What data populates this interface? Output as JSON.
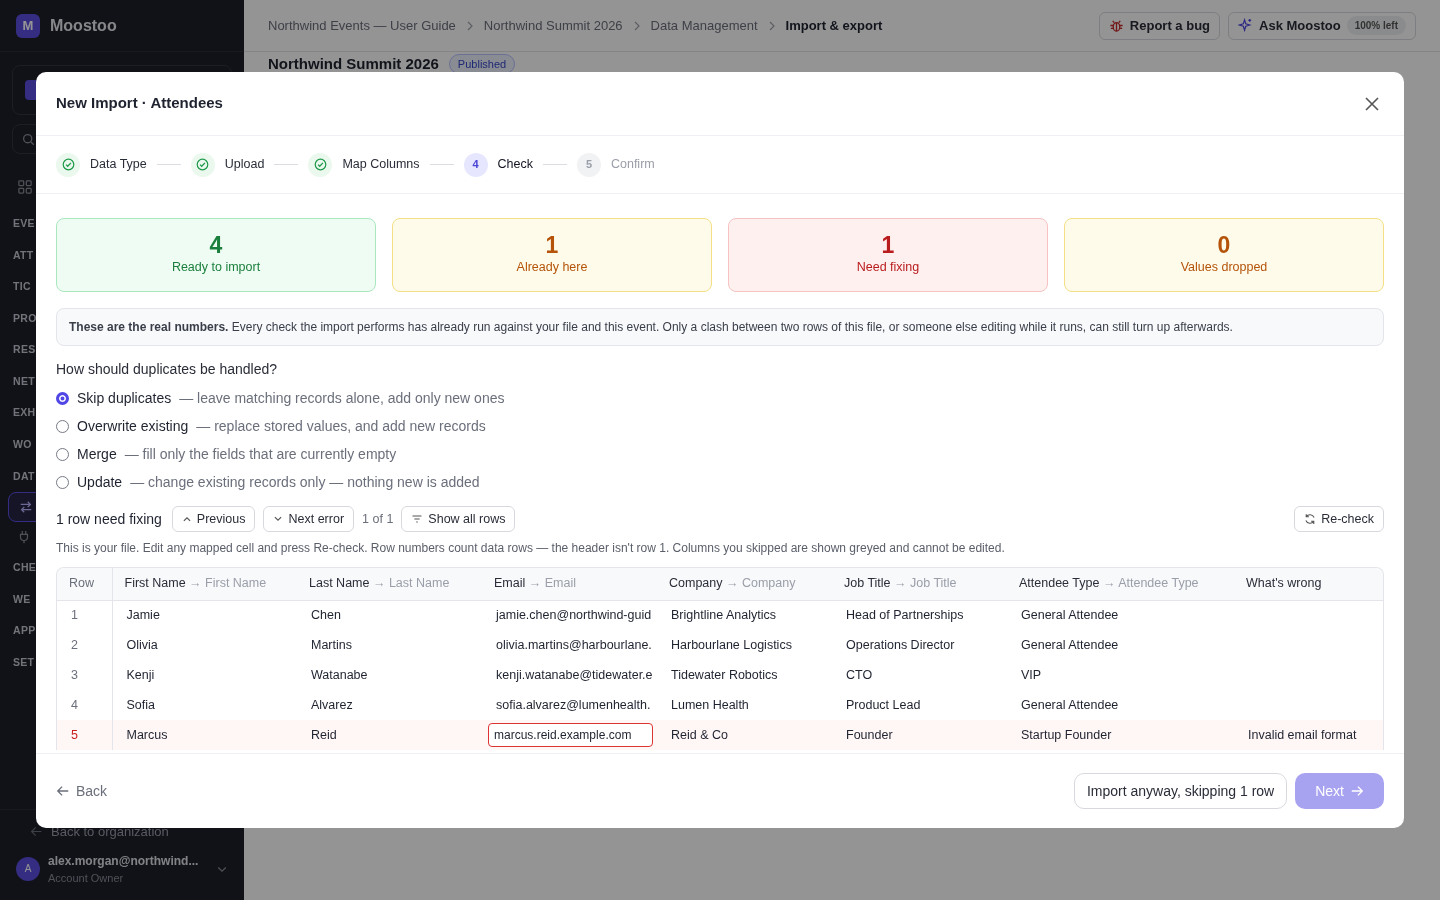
{
  "app": {
    "logo_letter": "M",
    "name": "Moostoo"
  },
  "sidebar": {
    "sections": [
      {
        "label": "EVE"
      },
      {
        "label": "ATT"
      },
      {
        "label": "TIC"
      },
      {
        "label": "PRO"
      },
      {
        "label": "RES"
      },
      {
        "label": "NET"
      },
      {
        "label": "EXH"
      },
      {
        "label": "WO"
      },
      {
        "label": "DAT"
      },
      {
        "label": "CHE"
      },
      {
        "label": "WE"
      },
      {
        "label": "APP"
      },
      {
        "label": "SET"
      }
    ],
    "back_link": "Back to organization",
    "user": {
      "avatar": "A",
      "email": "alex.morgan@northwind...",
      "role": "Account Owner"
    }
  },
  "breadcrumbs": [
    {
      "label": "Northwind Events — User Guide",
      "current": false
    },
    {
      "label": "Northwind Summit 2026",
      "current": false
    },
    {
      "label": "Data Management",
      "current": false
    },
    {
      "label": "Import & export",
      "current": true
    }
  ],
  "top_actions": {
    "report": "Report a bug",
    "ask": "Ask Moostoo",
    "ask_badge": "100% left"
  },
  "page": {
    "title": "Northwind Summit 2026",
    "status": "Published"
  },
  "modal": {
    "title": "New Import · Attendees",
    "steps": [
      {
        "label": "Data Type",
        "done": true,
        "current": false
      },
      {
        "label": "Upload",
        "done": true,
        "current": false
      },
      {
        "label": "Map Columns",
        "done": true,
        "current": false
      },
      {
        "number": "4",
        "label": "Check",
        "done": false,
        "current": true
      },
      {
        "number": "5",
        "label": "Confirm",
        "done": false,
        "current": false
      }
    ],
    "stats": [
      {
        "value": "4",
        "label": "Ready to import",
        "kind": "success"
      },
      {
        "value": "1",
        "label": "Already here",
        "kind": "warning"
      },
      {
        "value": "1",
        "label": "Need fixing",
        "kind": "danger"
      },
      {
        "value": "0",
        "label": "Values dropped",
        "kind": "warning"
      }
    ],
    "notice": "**These are the real numbers.** Every check the import performs has already run against your file and this event. Only a clash between two rows of this file, or someone else editing while it runs, can still turn up afterwards.",
    "duplicates": {
      "question": "How should duplicates be handled?",
      "options": [
        {
          "label": "Skip duplicates",
          "description": "— leave matching records alone, add only new ones",
          "selected": true
        },
        {
          "label": "Overwrite existing",
          "description": "— replace stored values, and add new records",
          "selected": false
        },
        {
          "label": "Merge",
          "description": "— fill only the fields that are currently empty",
          "selected": false
        },
        {
          "label": "Update",
          "description": "— change existing records only — nothing new is added",
          "selected": false
        }
      ]
    },
    "fix_bar": {
      "summary": "1 row need fixing",
      "previous": "Previous",
      "next": "Next error",
      "position": "1 of 1",
      "show_all": "Show all rows",
      "recheck": "Re-check"
    },
    "help": "This is your file. Edit any mapped cell and press Re-check. Row numbers count data rows — the header isn't row 1. Columns you skipped are shown greyed and cannot be edited.",
    "table": {
      "row_header": "Row",
      "columns": [
        {
          "source": "First Name",
          "target": "→ First Name"
        },
        {
          "source": "Last Name",
          "target": "→ Last Name"
        },
        {
          "source": "Email",
          "target": "→ Email"
        },
        {
          "source": "Company",
          "target": "→ Company"
        },
        {
          "source": "Job Title",
          "target": "→ Job Title"
        },
        {
          "source": "Attendee Type",
          "target": "→ Attendee Type"
        }
      ],
      "problem_header": "What's wrong",
      "rows": [
        {
          "number": "1",
          "error": false,
          "cells": [
            {
              "text": "Jamie",
              "invalid": false
            },
            {
              "text": "Chen",
              "invalid": false
            },
            {
              "text": "jamie.chen@northwind-guid",
              "invalid": false
            },
            {
              "text": "Brightline Analytics",
              "invalid": false
            },
            {
              "text": "Head of Partnerships",
              "invalid": false
            },
            {
              "text": "General Attendee",
              "invalid": false
            }
          ]
        },
        {
          "number": "2",
          "error": false,
          "cells": [
            {
              "text": "Olivia",
              "invalid": false
            },
            {
              "text": "Martins",
              "invalid": false
            },
            {
              "text": "olivia.martins@harbourlane.",
              "invalid": false
            },
            {
              "text": "Harbourlane Logistics",
              "invalid": false
            },
            {
              "text": "Operations Director",
              "invalid": false
            },
            {
              "text": "General Attendee",
              "invalid": false
            }
          ]
        },
        {
          "number": "3",
          "error": false,
          "cells": [
            {
              "text": "Kenji",
              "invalid": false
            },
            {
              "text": "Watanabe",
              "invalid": false
            },
            {
              "text": "kenji.watanabe@tidewater.e",
              "invalid": false
            },
            {
              "text": "Tidewater Robotics",
              "invalid": false
            },
            {
              "text": "CTO",
              "invalid": false
            },
            {
              "text": "VIP",
              "invalid": false
            }
          ]
        },
        {
          "number": "4",
          "error": false,
          "cells": [
            {
              "text": "Sofia",
              "invalid": false
            },
            {
              "text": "Alvarez",
              "invalid": false
            },
            {
              "text": "sofia.alvarez@lumenhealth.",
              "invalid": false
            },
            {
              "text": "Lumen Health",
              "invalid": false
            },
            {
              "text": "Product Lead",
              "invalid": false
            },
            {
              "text": "General Attendee",
              "invalid": false
            }
          ]
        },
        {
          "number": "5",
          "error": true,
          "problem": "Invalid email format",
          "cells": [
            {
              "text": "Marcus",
              "invalid": false
            },
            {
              "text": "Reid",
              "invalid": false
            },
            {
              "text": "marcus.reid.example.com",
              "invalid": true
            },
            {
              "text": "Reid & Co",
              "invalid": false
            },
            {
              "text": "Founder",
              "invalid": false
            },
            {
              "text": "Startup Founder",
              "invalid": false
            }
          ]
        }
      ]
    },
    "footer": {
      "back": "Back",
      "skip": "Import anyway, skipping 1 row",
      "next": "Next",
      "next_disabled": true
    }
  }
}
